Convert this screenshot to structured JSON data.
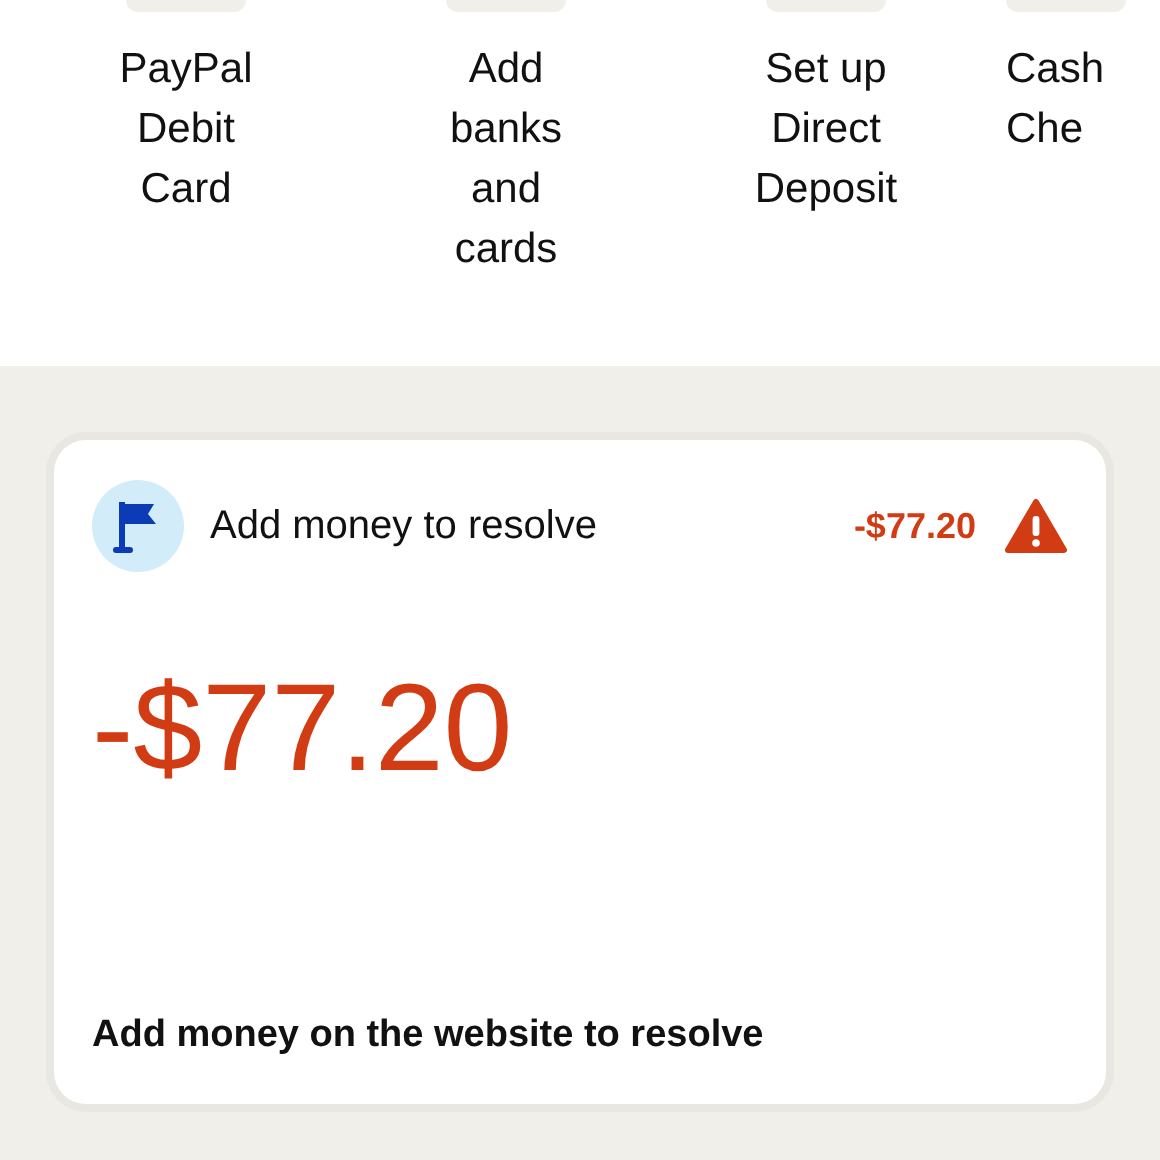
{
  "quick_actions": [
    {
      "label": "PayPal Debit Card"
    },
    {
      "label": "Add banks and cards"
    },
    {
      "label": "Set up Direct Deposit"
    },
    {
      "label": "Cash Che"
    }
  ],
  "alert_card": {
    "title": "Add money to resolve",
    "header_amount": "-$77.20",
    "amount": "-$77.20",
    "message": "Add money on the website to resolve"
  }
}
